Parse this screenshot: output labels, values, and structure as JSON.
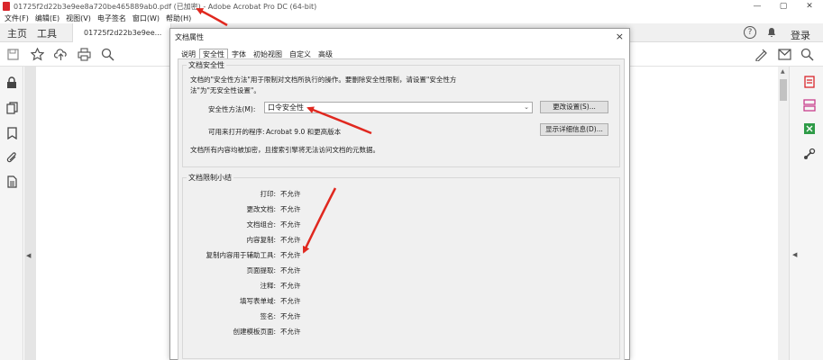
{
  "window": {
    "title": "01725f2d22b3e9ee8a720be465889ab0.pdf (已加密) - Adobe Acrobat Pro DC (64-bit)",
    "controls": [
      "—",
      "▢",
      "✕"
    ]
  },
  "menu": [
    "文件(F)",
    "编辑(E)",
    "视图(V)",
    "电子签名",
    "窗口(W)",
    "帮助(H)"
  ],
  "tabs": {
    "home": "主页",
    "tools": "工具",
    "doc": "01725f2d22b3e9ee...",
    "doc_close": "×",
    "help_icon": "?",
    "login": "登录"
  },
  "toolbar_icons": [
    "save-icon",
    "star-icon",
    "upload-icon",
    "print-icon",
    "zoom-icon"
  ],
  "right_toolbar_icons": [
    "sign-icon",
    "mail-icon",
    "search-icon"
  ],
  "left_icons": [
    "lock-icon",
    "copy-icon",
    "bookmark-icon",
    "attachment-icon",
    "page-icon"
  ],
  "right_icons": [
    "pdf-export-icon",
    "organize-icon",
    "excel-icon",
    "tools-more-icon"
  ],
  "collapse_left": "◀",
  "collapse_right": "◀",
  "dialog": {
    "title": "文档属性",
    "close": "×",
    "tabs": [
      "说明",
      "安全性",
      "字体",
      "初始视图",
      "自定义",
      "高级"
    ],
    "security_group": "文档安全性",
    "description_line1": "文档的\"安全性方法\"用于限制对文档所执行的操作。要删除安全性限制，请设置\"安全性方",
    "description_line2": "法\"为\"无安全性设置\"。",
    "method_label": "安全性方法(M):",
    "method_value": "口令安全性",
    "change_settings": "更改设置(S)...",
    "open_with_label": "可用来打开的程序:",
    "open_with_value": "Acrobat 9.0 和更高版本",
    "show_details": "显示详细信息(D)...",
    "encrypt_note": "文档所有内容均被加密，且搜索引擎将无法访问文档的元数据。",
    "restrictions_group": "文档限制小结",
    "restrictions": [
      {
        "label": "打印:",
        "value": "不允许"
      },
      {
        "label": "更改文档:",
        "value": "不允许"
      },
      {
        "label": "文档组合:",
        "value": "不允许"
      },
      {
        "label": "内容复制:",
        "value": "不允许"
      },
      {
        "label": "复制内容用于辅助工具:",
        "value": "不允许"
      },
      {
        "label": "页面提取:",
        "value": "不允许"
      },
      {
        "label": "注释:",
        "value": "不允许"
      },
      {
        "label": "填写表单域:",
        "value": "不允许"
      },
      {
        "label": "签名:",
        "value": "不允许"
      },
      {
        "label": "创建模板页面:",
        "value": "不允许"
      }
    ]
  },
  "colors": {
    "accent_red": "#e0281f",
    "pdf_red": "#d9262b",
    "excel_green": "#2e9b47",
    "organize_pink": "#c83e8c"
  }
}
